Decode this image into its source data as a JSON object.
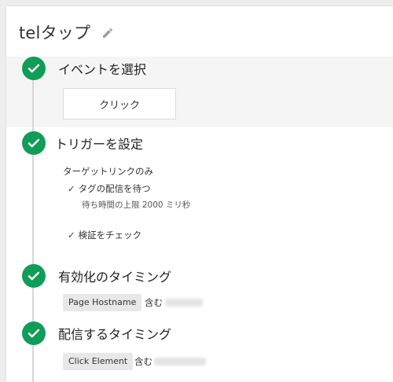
{
  "title": "telタップ",
  "steps": {
    "event": {
      "title": "イベントを選択",
      "option": "クリック"
    },
    "trigger": {
      "title": "トリガーを設定",
      "scope": "ターゲットリンクのみ",
      "wait_tags": "タグの配信を待つ",
      "max_wait": "待ち時間の上限 2000 ミリ秒",
      "validate": "検証をチェック"
    },
    "enable": {
      "title": "有効化のタイミング",
      "variable": "Page Hostname",
      "operator": "含む"
    },
    "fire": {
      "title": "配信するタイミング",
      "variable": "Click Element",
      "operator": "含む"
    }
  },
  "colors": {
    "check": "#0f9d58",
    "band": "#f5f5f5"
  },
  "icons": [
    "pencil-icon",
    "check-circle-icon",
    "checkmark-icon"
  ]
}
